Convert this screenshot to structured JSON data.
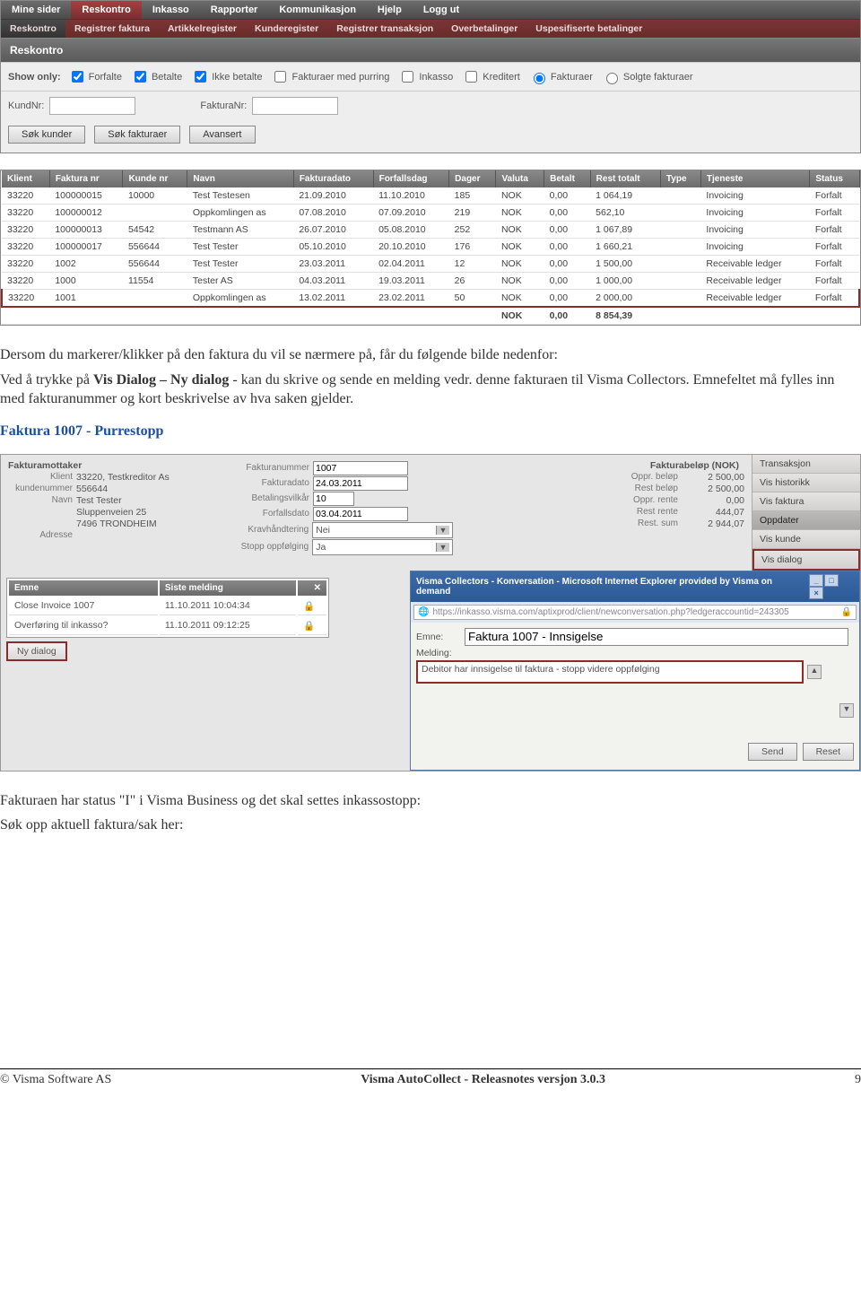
{
  "nav1": [
    "Mine sider",
    "Reskontro",
    "Inkasso",
    "Rapporter",
    "Kommunikasjon",
    "Hjelp",
    "Logg ut"
  ],
  "nav1_active": 1,
  "nav2": [
    "Reskontro",
    "Registrer faktura",
    "Artikkelregister",
    "Kunderegister",
    "Registrer transaksjon",
    "Overbetalinger",
    "Uspesifiserte betalinger"
  ],
  "nav2_active": 0,
  "panelTitle": "Reskontro",
  "filter": {
    "label": "Show only:",
    "checks": [
      {
        "label": "Forfalte",
        "checked": true
      },
      {
        "label": "Betalte",
        "checked": true
      },
      {
        "label": "Ikke betalte",
        "checked": true
      },
      {
        "label": "Fakturaer med purring",
        "checked": false
      },
      {
        "label": "Inkasso",
        "checked": false
      },
      {
        "label": "Kreditert",
        "checked": false
      }
    ],
    "radios": [
      {
        "label": "Fakturaer",
        "checked": true
      },
      {
        "label": "Solgte fakturaer",
        "checked": false
      }
    ]
  },
  "search": {
    "kundnr": "KundNr:",
    "fakturanr": "FakturaNr:"
  },
  "buttons": [
    "Søk kunder",
    "Søk fakturaer",
    "Avansert"
  ],
  "table": {
    "headers": [
      "Klient",
      "Faktura nr",
      "Kunde nr",
      "Navn",
      "Fakturadato",
      "Forfallsdag",
      "Dager",
      "Valuta",
      "Betalt",
      "Rest totalt",
      "Type",
      "Tjeneste",
      "Status"
    ],
    "rows": [
      [
        "33220",
        "100000015",
        "10000",
        "Test Testesen",
        "21.09.2010",
        "11.10.2010",
        "185",
        "NOK",
        "0,00",
        "1 064,19",
        "",
        "Invoicing",
        "Forfalt"
      ],
      [
        "33220",
        "100000012",
        "",
        "Oppkomlingen as",
        "07.08.2010",
        "07.09.2010",
        "219",
        "NOK",
        "0,00",
        "562,10",
        "",
        "Invoicing",
        "Forfalt"
      ],
      [
        "33220",
        "100000013",
        "54542",
        "Testmann AS",
        "26.07.2010",
        "05.08.2010",
        "252",
        "NOK",
        "0,00",
        "1 067,89",
        "",
        "Invoicing",
        "Forfalt"
      ],
      [
        "33220",
        "100000017",
        "556644",
        "Test Tester",
        "05.10.2010",
        "20.10.2010",
        "176",
        "NOK",
        "0,00",
        "1 660,21",
        "",
        "Invoicing",
        "Forfalt"
      ],
      [
        "33220",
        "1002",
        "556644",
        "Test Tester",
        "23.03.2011",
        "02.04.2011",
        "12",
        "NOK",
        "0,00",
        "1 500,00",
        "",
        "Receivable ledger",
        "Forfalt"
      ],
      [
        "33220",
        "1000",
        "11554",
        "Tester AS",
        "04.03.2011",
        "19.03.2011",
        "26",
        "NOK",
        "0,00",
        "1 000,00",
        "",
        "Receivable ledger",
        "Forfalt"
      ],
      [
        "33220",
        "1001",
        "",
        "Oppkomlingen as",
        "13.02.2011",
        "23.02.2011",
        "50",
        "NOK",
        "0,00",
        "2 000,00",
        "",
        "Receivable ledger",
        "Forfalt"
      ]
    ],
    "hl_row_index": 6,
    "total": [
      "",
      "",
      "",
      "",
      "",
      "",
      "",
      "NOK",
      "0,00",
      "8 854,39",
      "",
      "",
      ""
    ]
  },
  "prose": {
    "p1": "Dersom du markerer/klikker på den faktura du vil se nærmere på, får du følgende bilde nedenfor:",
    "p2a": "Ved å trykke på ",
    "p2b": "Vis Dialog – Ny dialog",
    "p2c": " - kan du skrive og sende en melding vedr. denne fakturaen til Visma Collectors. Emnefeltet må fylles inn med fakturanummer og kort beskrivelse av hva saken gjelder.",
    "p3": "Faktura 1007 - Purrestopp"
  },
  "detail": {
    "mottaker_title": "Fakturamottaker",
    "mottaker": [
      {
        "lbl": "Klient",
        "val": "33220, Testkreditor As"
      },
      {
        "lbl": "kundenummer",
        "val": "556644"
      },
      {
        "lbl": "Navn",
        "val": "Test Tester"
      },
      {
        "lbl": "",
        "val": "Sluppenveien 25"
      },
      {
        "lbl": "",
        "val": "7496 TRONDHEIM"
      },
      {
        "lbl": "Adresse",
        "val": ""
      }
    ],
    "mid": [
      {
        "lbl": "Fakturanummer",
        "val": "1007",
        "type": "input",
        "w": "100"
      },
      {
        "lbl": "Fakturadato",
        "val": "24.03.2011",
        "type": "input",
        "w": "100"
      },
      {
        "lbl": "Betalingsvilkår",
        "val": "10",
        "type": "input",
        "w": "40"
      },
      {
        "lbl": "Forfallsdato",
        "val": "03.04.2011",
        "type": "input",
        "w": "100"
      },
      {
        "lbl": "Kravhåndtering",
        "val": "Nei",
        "type": "drop"
      },
      {
        "lbl": "Stopp oppfølging",
        "val": "Ja",
        "type": "drop"
      }
    ],
    "belop_title": "Fakturabeløp (NOK)",
    "belop": [
      {
        "lbl": "Oppr. beløp",
        "val": "2 500,00"
      },
      {
        "lbl": "Rest beløp",
        "val": "2 500,00"
      },
      {
        "lbl": "Oppr. rente",
        "val": "0,00"
      },
      {
        "lbl": "Rest rente",
        "val": "444,07"
      },
      {
        "lbl": "Rest. sum",
        "val": "2 944,07"
      }
    ],
    "sidebar": [
      "Transaksjon",
      "Vis historikk",
      "Vis faktura",
      "Oppdater",
      "Vis kunde",
      "Vis dialog"
    ],
    "sidebar_active": 3,
    "sidebar_hl": 5
  },
  "emne": {
    "headers": [
      "Emne",
      "Siste melding"
    ],
    "rows": [
      [
        "Close Invoice 1007",
        "11.10.2011 10:04:34"
      ],
      [
        "Overføring til inkasso?",
        "11.10.2011 09:12:25"
      ]
    ],
    "nydialog": "Ny dialog"
  },
  "ie": {
    "title": "Visma Collectors - Konversation - Microsoft Internet Explorer provided by Visma on demand",
    "url": "https://inkasso.visma.com/aptixprod/client/newconversation.php?ledgeraccountid=243305",
    "emne_lbl": "Emne:",
    "emne_val": "Faktura 1007 - Innsigelse",
    "melding_lbl": "Melding:",
    "melding_val": "Debitor har innsigelse til faktura - stopp videre oppfølging",
    "send": "Send",
    "reset": "Reset"
  },
  "after_p": "Fakturaen har status \"I\" i Visma Business og det skal settes inkassostopp:",
  "after_p2": "Søk opp aktuell faktura/sak her:",
  "footer": {
    "left": "© Visma Software AS",
    "center": "Visma AutoCollect - Releasnotes versjon  3.0.3",
    "right": "9"
  }
}
